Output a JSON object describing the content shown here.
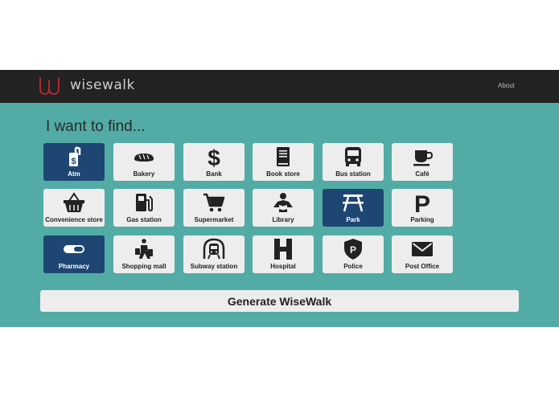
{
  "navbar": {
    "brand": "wisewalk",
    "about_label": "About",
    "logo_color": "#c0282d"
  },
  "main": {
    "heading": "I want to find...",
    "generate_label": "Generate WiseWalk"
  },
  "places": [
    {
      "label": "Atm",
      "icon": "atm-icon",
      "selected": true
    },
    {
      "label": "Bakery",
      "icon": "bread-icon",
      "selected": false
    },
    {
      "label": "Bank",
      "icon": "dollar-icon",
      "selected": false
    },
    {
      "label": "Book store",
      "icon": "book-icon",
      "selected": false
    },
    {
      "label": "Bus station",
      "icon": "bus-icon",
      "selected": false
    },
    {
      "label": "Café",
      "icon": "coffee-cup-icon",
      "selected": false
    },
    {
      "label": "Convenience store",
      "icon": "basket-icon",
      "selected": false
    },
    {
      "label": "Gas station",
      "icon": "fuel-pump-icon",
      "selected": false
    },
    {
      "label": "Supermarket",
      "icon": "shopping-cart-icon",
      "selected": false
    },
    {
      "label": "Library",
      "icon": "reader-icon",
      "selected": false
    },
    {
      "label": "Park",
      "icon": "picnic-table-icon",
      "selected": true
    },
    {
      "label": "Parking",
      "icon": "parking-icon",
      "selected": false
    },
    {
      "label": "Pharmacy",
      "icon": "pill-icon",
      "selected": true
    },
    {
      "label": "Shopping mall",
      "icon": "shopper-icon",
      "selected": false
    },
    {
      "label": "Subway station",
      "icon": "subway-icon",
      "selected": false
    },
    {
      "label": "Hospital",
      "icon": "hospital-icon",
      "selected": false
    },
    {
      "label": "Police",
      "icon": "police-badge-icon",
      "selected": false
    },
    {
      "label": "Post Office",
      "icon": "envelope-icon",
      "selected": false
    }
  ],
  "colors": {
    "navbar_bg": "#222222",
    "main_bg": "#52aca5",
    "tile_bg": "#ededed",
    "tile_selected_bg": "#1d4673"
  }
}
